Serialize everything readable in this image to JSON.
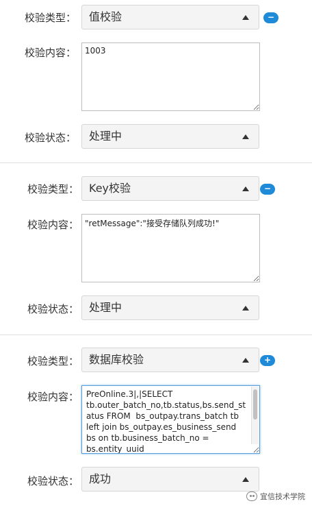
{
  "groups": [
    {
      "type_label": "校验类型：",
      "type_value": "值校验",
      "toggle": "−",
      "content_label": "校验内容：",
      "content_value": "1003",
      "status_label": "校验状态：",
      "status_value": "处理中"
    },
    {
      "type_label": "校验类型：",
      "type_value": "Key校验",
      "toggle": "−",
      "content_label": "校验内容：",
      "content_value": "\"retMessage\":\"接受存储队列成功!\"",
      "status_label": "校验状态：",
      "status_value": "处理中"
    },
    {
      "type_label": "校验类型：",
      "type_value": "数据库校验",
      "toggle": "+",
      "content_label": "校验内容：",
      "content_value": "PreOnline.3|,|SELECT tb.outer_batch_no,tb.status,bs.send_status FROM  bs_outpay.trans_batch tb left join bs_outpay.es_business_send bs on tb.business_batch_no = bs.entity_uuid",
      "status_label": "校验状态：",
      "status_value": "成功"
    }
  ],
  "watermark": {
    "text": "宜信技术学院",
    "icon": "wechat-icon"
  },
  "colors": {
    "accent": "#1f8ad7",
    "focus": "#5b9dd9"
  }
}
